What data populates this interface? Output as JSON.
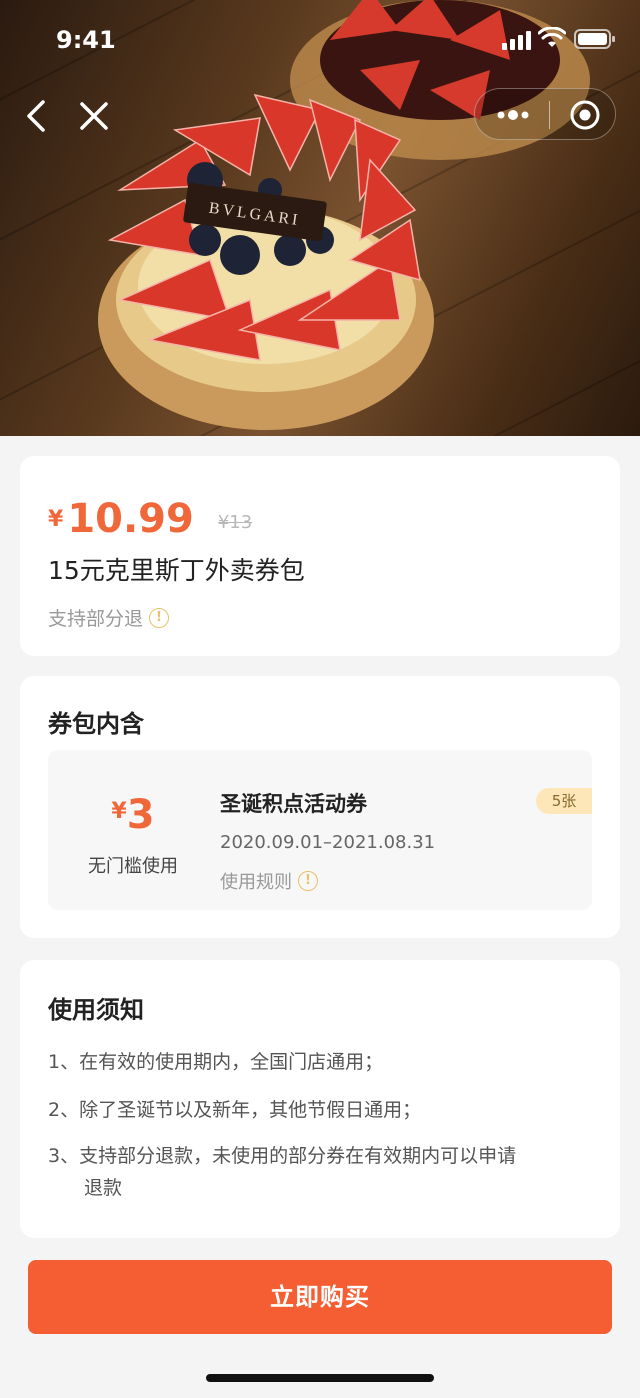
{
  "status_bar": {
    "time": "9:41"
  },
  "hero": {
    "brand_on_plaque": "BVLGARI"
  },
  "product": {
    "currency": "¥",
    "price": "10.99",
    "original_price": "¥13",
    "title": "15元克里斯丁外卖券包",
    "refund_note": "支持部分退"
  },
  "bundle": {
    "section_title": "券包内含",
    "coupon": {
      "currency": "¥",
      "value": "3",
      "threshold": "无门槛使用",
      "name": "圣诞积点活动券",
      "dates": "2020.09.01–2021.08.31",
      "rules_label": "使用规则",
      "count": "5张"
    }
  },
  "notes": {
    "section_title": "使用须知",
    "items": [
      {
        "num": "1、",
        "text": "在有效的使用期内，全国门店通用；"
      },
      {
        "num": "2、",
        "text": "除了圣诞节以及新年，其他节假日通用；"
      },
      {
        "num": "3、",
        "text": "支持部分退款，未使用的部分券在有效期内可以申请",
        "cont": "退款"
      }
    ]
  },
  "actions": {
    "buy_label": "立即购买"
  },
  "colors": {
    "accent": "#f0673a",
    "button": "#f55e33",
    "badge_bg": "#fde6b8",
    "info_icon": "#e8c168"
  }
}
